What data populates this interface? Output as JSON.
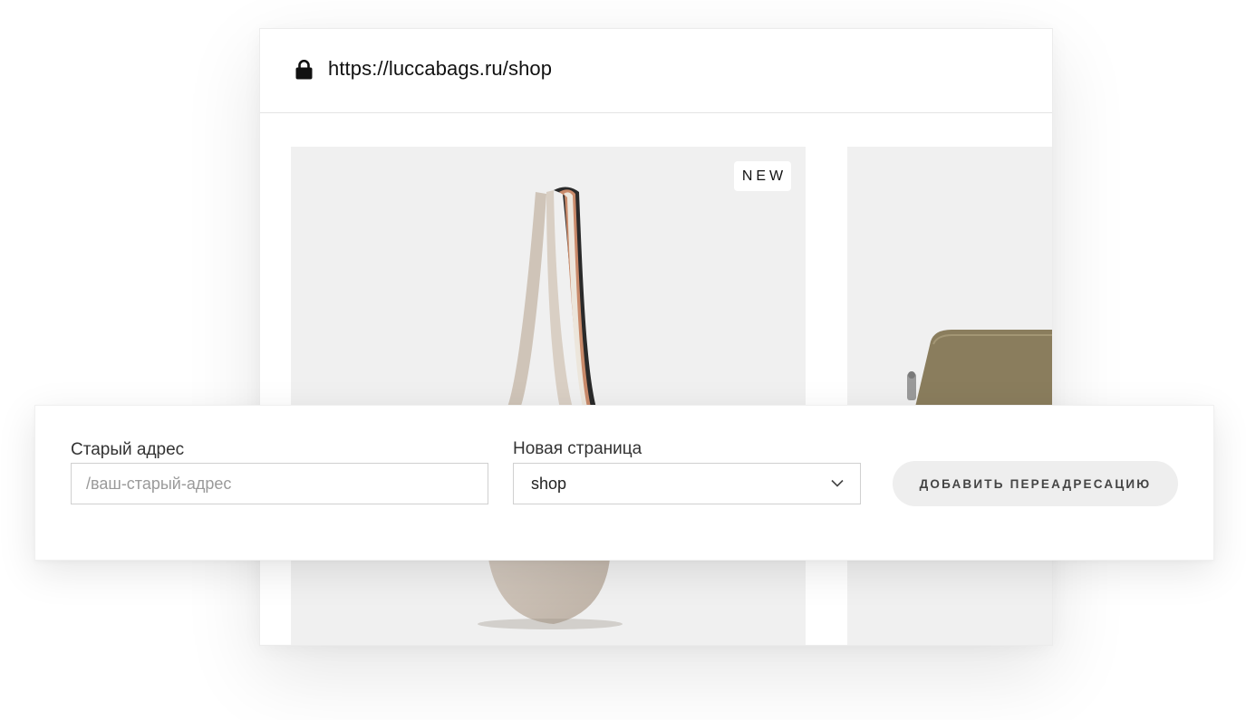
{
  "browser": {
    "url": "https://luccabags.ru/shop",
    "lock_icon": "lock-icon"
  },
  "products": [
    {
      "badge": "NEW",
      "image": "crossbody-bag-beige-striped-strap"
    },
    {
      "image": "olive-leather-bag"
    }
  ],
  "redirect_form": {
    "old_address_label": "Старый адрес",
    "old_address_placeholder": "/ваш-старый-адрес",
    "old_address_value": "",
    "new_page_label": "Новая страница",
    "new_page_selected": "shop",
    "dropdown_icon": "chevron-down-icon",
    "add_button_label": "ДОБАВИТЬ ПЕРЕАДРЕСАЦИЮ"
  },
  "colors": {
    "card_background": "#f0f0f0",
    "button_background": "#eeeeee",
    "text_primary": "#111111"
  }
}
